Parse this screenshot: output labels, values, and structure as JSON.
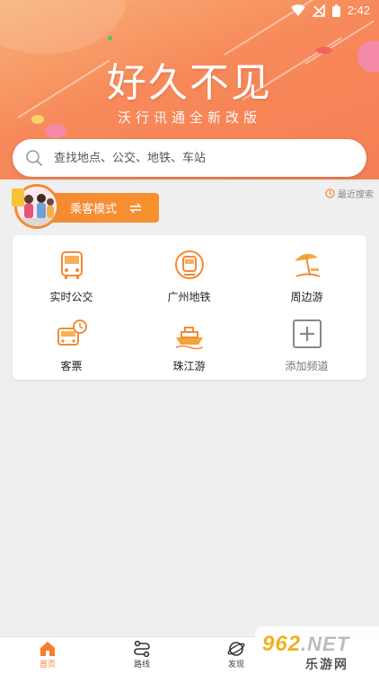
{
  "status_bar": {
    "time": "2:42"
  },
  "hero": {
    "title": "好久不见",
    "subtitle": "沃行讯通全新改版",
    "gradient_from": "#f7b278",
    "gradient_to": "#f57f55"
  },
  "search": {
    "placeholder": "查找地点、公交、地铁、车站"
  },
  "recent_search": {
    "label": "最近搜索"
  },
  "mode": {
    "label": "乘客模式",
    "accent": "#f48a34"
  },
  "services": [
    {
      "label": "实时公交",
      "icon": "bus-realtime-icon"
    },
    {
      "label": "广州地铁",
      "icon": "metro-icon"
    },
    {
      "label": "周边游",
      "icon": "beach-umbrella-icon"
    },
    {
      "label": "客票",
      "icon": "bus-ticket-icon"
    },
    {
      "label": "珠江游",
      "icon": "cruise-ship-icon"
    },
    {
      "label": "添加频道",
      "icon": "add-channel-icon"
    }
  ],
  "tabs": [
    {
      "label": "首页",
      "icon": "home-icon",
      "active": true
    },
    {
      "label": "路线",
      "icon": "route-icon",
      "active": false
    },
    {
      "label": "发现",
      "icon": "discover-icon",
      "active": false
    }
  ],
  "watermark": {
    "brand": "962",
    "net": ".NET",
    "sub": "乐游网"
  }
}
